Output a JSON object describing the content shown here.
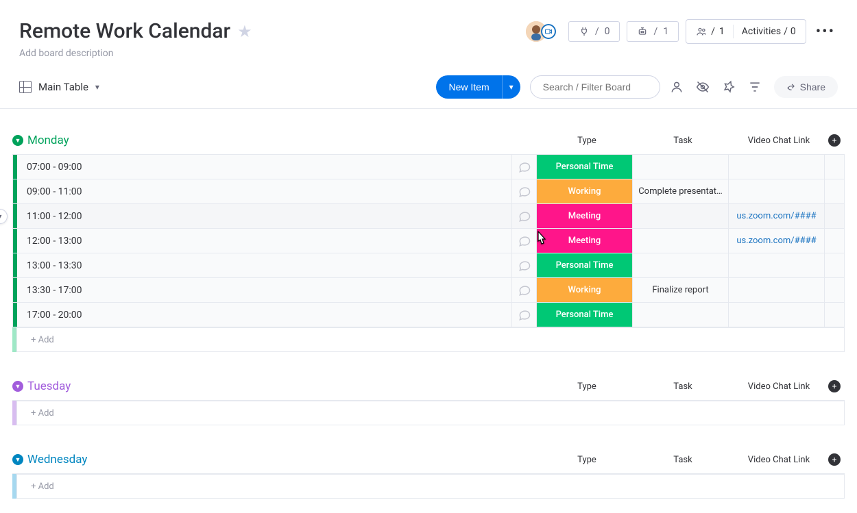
{
  "header": {
    "title": "Remote Work Calendar",
    "description": "Add board description",
    "integrations_count": "0",
    "automations_count": "1",
    "members_count": "1",
    "activities_label": "Activities",
    "activities_count": "0"
  },
  "toolbar": {
    "view_label": "Main Table",
    "new_item_label": "New Item",
    "search_placeholder": "Search / Filter Board",
    "share_label": "Share"
  },
  "columns": {
    "type": "Type",
    "task": "Task",
    "video": "Video Chat Link"
  },
  "type_colors": {
    "Personal Time": "#00c875",
    "Working": "#fdab3d",
    "Meeting": "#e2445c_pink"
  },
  "groups": [
    {
      "name": "Monday",
      "color": "#00a25b",
      "stripe": "#00a25b",
      "light_stripe": "#9fe8c6",
      "rows": [
        {
          "time": "07:00 - 09:00",
          "type": "Personal Time",
          "type_color": "#00c875",
          "task": "",
          "link": ""
        },
        {
          "time": "09:00 - 11:00",
          "type": "Working",
          "type_color": "#fdab3d",
          "task": "Complete presentat…",
          "link": ""
        },
        {
          "time": "11:00 - 12:00",
          "type": "Meeting",
          "type_color": "#ff158a",
          "task": "",
          "link": "us.zoom.com/####",
          "hover": true
        },
        {
          "time": "12:00 - 13:00",
          "type": "Meeting",
          "type_color": "#ff158a",
          "task": "",
          "link": "us.zoom.com/####"
        },
        {
          "time": "13:00 - 13:30",
          "type": "Personal Time",
          "type_color": "#00c875",
          "task": "",
          "link": ""
        },
        {
          "time": "13:30 - 17:00",
          "type": "Working",
          "type_color": "#fdab3d",
          "task": "Finalize report",
          "link": ""
        },
        {
          "time": "17:00 - 20:00",
          "type": "Personal Time",
          "type_color": "#00c875",
          "task": "",
          "link": ""
        }
      ],
      "add_label": "+ Add"
    },
    {
      "name": "Tuesday",
      "color": "#a25ddc",
      "stripe": "#a25ddc",
      "light_stripe": "#d8bdf0",
      "rows": [],
      "add_label": "+ Add"
    },
    {
      "name": "Wednesday",
      "color": "#0086c0",
      "stripe": "#0086c0",
      "light_stripe": "#a6d8ef",
      "rows": [],
      "add_label": "+ Add"
    }
  ]
}
